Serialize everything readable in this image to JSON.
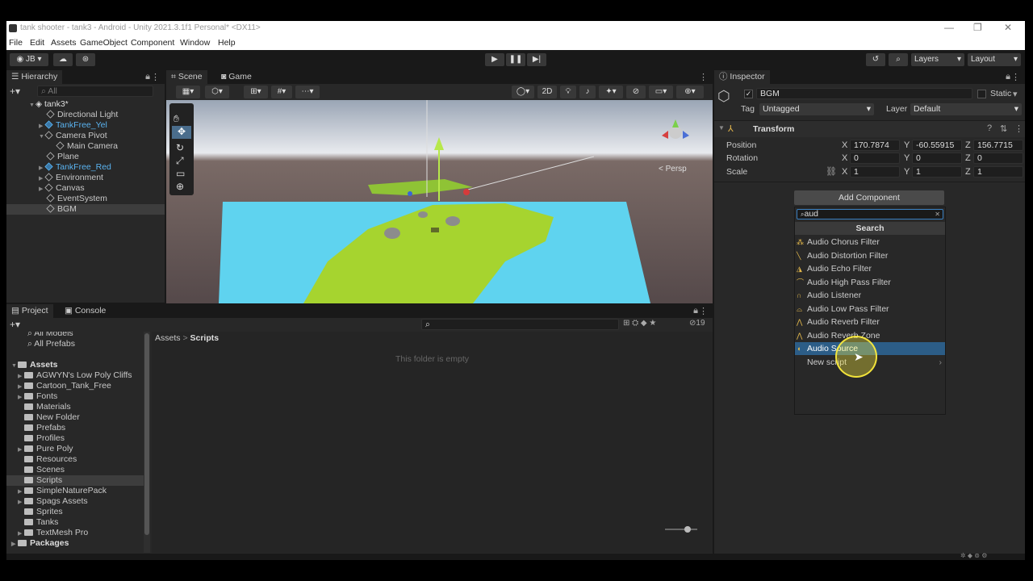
{
  "window": {
    "title": "tank shooter - tank3 - Android - Unity 2021.3.1f1 Personal* <DX11>"
  },
  "menu": [
    "File",
    "Edit",
    "Assets",
    "GameObject",
    "Component",
    "Window",
    "Help"
  ],
  "toolbar": {
    "account": "JB",
    "layers": "Layers",
    "layout": "Layout"
  },
  "hierarchy": {
    "tab": "Hierarchy",
    "search_placeholder": "All",
    "items": [
      {
        "label": "tank3*"
      },
      {
        "label": "Directional Light"
      },
      {
        "label": "TankFree_Yel"
      },
      {
        "label": "Camera Pivot"
      },
      {
        "label": "Main Camera"
      },
      {
        "label": "Plane"
      },
      {
        "label": "TankFree_Red"
      },
      {
        "label": "Environment"
      },
      {
        "label": "Canvas"
      },
      {
        "label": "EventSystem"
      },
      {
        "label": "BGM"
      }
    ]
  },
  "scene": {
    "tabs": [
      "Scene",
      "Game"
    ],
    "mode_2d": "2D",
    "persp": "< Persp"
  },
  "project": {
    "tabs": [
      "Project",
      "Console"
    ],
    "favorites": [
      "All Models",
      "All Prefabs"
    ],
    "assets_root": "Assets",
    "folders": [
      "AGWYN's Low Poly Cliffs",
      "Cartoon_Tank_Free",
      "Fonts",
      "Materials",
      "New Folder",
      "Prefabs",
      "Profiles",
      "Pure Poly",
      "Resources",
      "Scenes",
      "Scripts",
      "SimpleNaturePack",
      "Spags Assets",
      "Sprites",
      "Tanks",
      "TextMesh Pro"
    ],
    "packages": "Packages",
    "breadcrumb": [
      "Assets",
      "Scripts"
    ],
    "empty_text": "This folder is empty",
    "hidden_count": "19"
  },
  "inspector": {
    "tab": "Inspector",
    "object_name": "BGM",
    "static_label": "Static",
    "tag_label": "Tag",
    "tag_value": "Untagged",
    "layer_label": "Layer",
    "layer_value": "Default",
    "transform": "Transform",
    "position": {
      "label": "Position",
      "x": "170.7874",
      "y": "-60.55915",
      "z": "156.7715"
    },
    "rotation": {
      "label": "Rotation",
      "x": "0",
      "y": "0",
      "z": "0"
    },
    "scale": {
      "label": "Scale",
      "x": "1",
      "y": "1",
      "z": "1"
    },
    "add_component": "Add Component",
    "search_value": "aud",
    "search_header": "Search",
    "components": [
      "Audio Chorus Filter",
      "Audio Distortion Filter",
      "Audio Echo Filter",
      "Audio High Pass Filter",
      "Audio Listener",
      "Audio Low Pass Filter",
      "Audio Reverb Filter",
      "Audio Reverb Zone",
      "Audio Source",
      "New script"
    ]
  },
  "colors": {
    "accent": "#2c5d87",
    "blue_object": "#5ab3f0"
  }
}
